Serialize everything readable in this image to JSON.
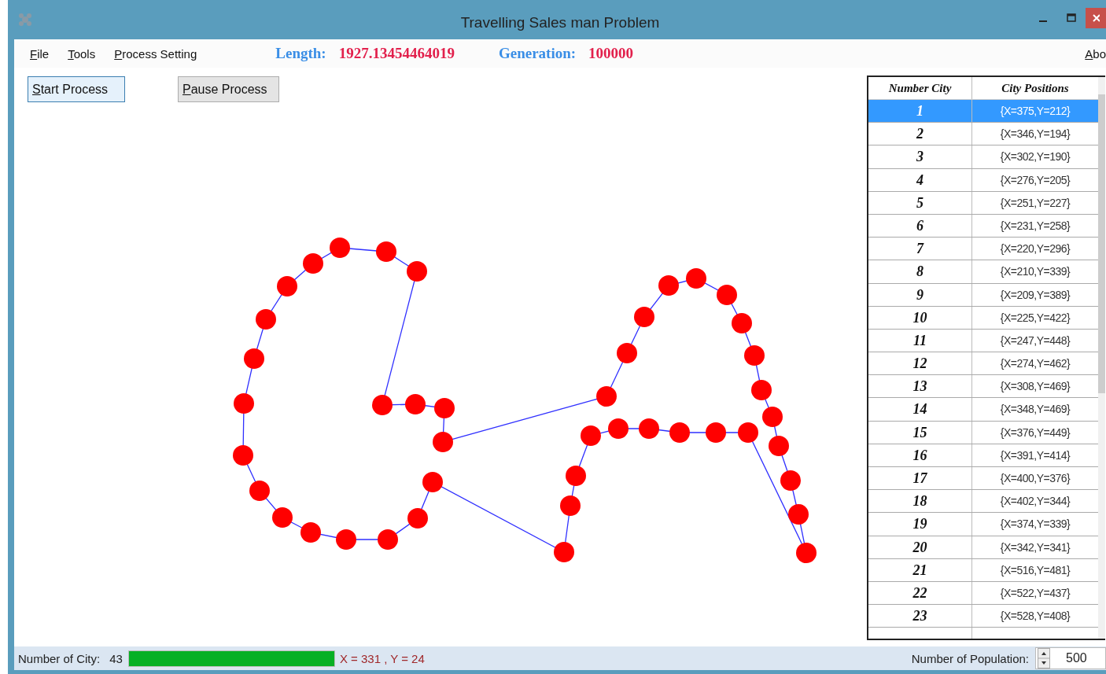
{
  "window": {
    "title": "Travelling Sales man Problem"
  },
  "menu": [
    {
      "label": "File"
    },
    {
      "label": "Tools"
    },
    {
      "label": "Process Setting"
    },
    {
      "label": "Abo"
    }
  ],
  "stats": [
    {
      "label": "Length:",
      "value": "1927.13454464019"
    },
    {
      "label": "Generation:",
      "value": "100000"
    }
  ],
  "buttons": [
    {
      "label": "Start Process",
      "selected": true
    },
    {
      "label": "Pause Process",
      "selected": false
    }
  ],
  "table": {
    "columns": [
      "Number City",
      "City Positions"
    ],
    "rows": [
      {
        "cells": [
          "1",
          "{X=375,Y=212}"
        ],
        "selected": true
      },
      {
        "cells": [
          "2",
          "{X=346,Y=194}"
        ],
        "selected": false
      },
      {
        "cells": [
          "3",
          "{X=302,Y=190}"
        ],
        "selected": false
      },
      {
        "cells": [
          "4",
          "{X=276,Y=205}"
        ],
        "selected": false
      },
      {
        "cells": [
          "5",
          "{X=251,Y=227}"
        ],
        "selected": false
      },
      {
        "cells": [
          "6",
          "{X=231,Y=258}"
        ],
        "selected": false
      },
      {
        "cells": [
          "7",
          "{X=220,Y=296}"
        ],
        "selected": false
      },
      {
        "cells": [
          "8",
          "{X=210,Y=339}"
        ],
        "selected": false
      },
      {
        "cells": [
          "9",
          "{X=209,Y=389}"
        ],
        "selected": false
      },
      {
        "cells": [
          "10",
          "{X=225,Y=422}"
        ],
        "selected": false
      },
      {
        "cells": [
          "11",
          "{X=247,Y=448}"
        ],
        "selected": false
      },
      {
        "cells": [
          "12",
          "{X=274,Y=462}"
        ],
        "selected": false
      },
      {
        "cells": [
          "13",
          "{X=308,Y=469}"
        ],
        "selected": false
      },
      {
        "cells": [
          "14",
          "{X=348,Y=469}"
        ],
        "selected": false
      },
      {
        "cells": [
          "15",
          "{X=376,Y=449}"
        ],
        "selected": false
      },
      {
        "cells": [
          "16",
          "{X=391,Y=414}"
        ],
        "selected": false
      },
      {
        "cells": [
          "17",
          "{X=400,Y=376}"
        ],
        "selected": false
      },
      {
        "cells": [
          "18",
          "{X=402,Y=344}"
        ],
        "selected": false
      },
      {
        "cells": [
          "19",
          "{X=374,Y=339}"
        ],
        "selected": false
      },
      {
        "cells": [
          "20",
          "{X=342,Y=341}"
        ],
        "selected": false
      },
      {
        "cells": [
          "21",
          "{X=516,Y=481}"
        ],
        "selected": false
      },
      {
        "cells": [
          "22",
          "{X=522,Y=437}"
        ],
        "selected": false
      },
      {
        "cells": [
          "23",
          "{X=528,Y=408}"
        ],
        "selected": false
      }
    ]
  },
  "status_bar": {
    "city_label": "Number of City:",
    "city_count": "43",
    "progress": {
      "level": 1
    },
    "mouse_position": "X = 331 ,  Y = 24",
    "population_label": "Number of Population:",
    "population_value": "500"
  }
}
